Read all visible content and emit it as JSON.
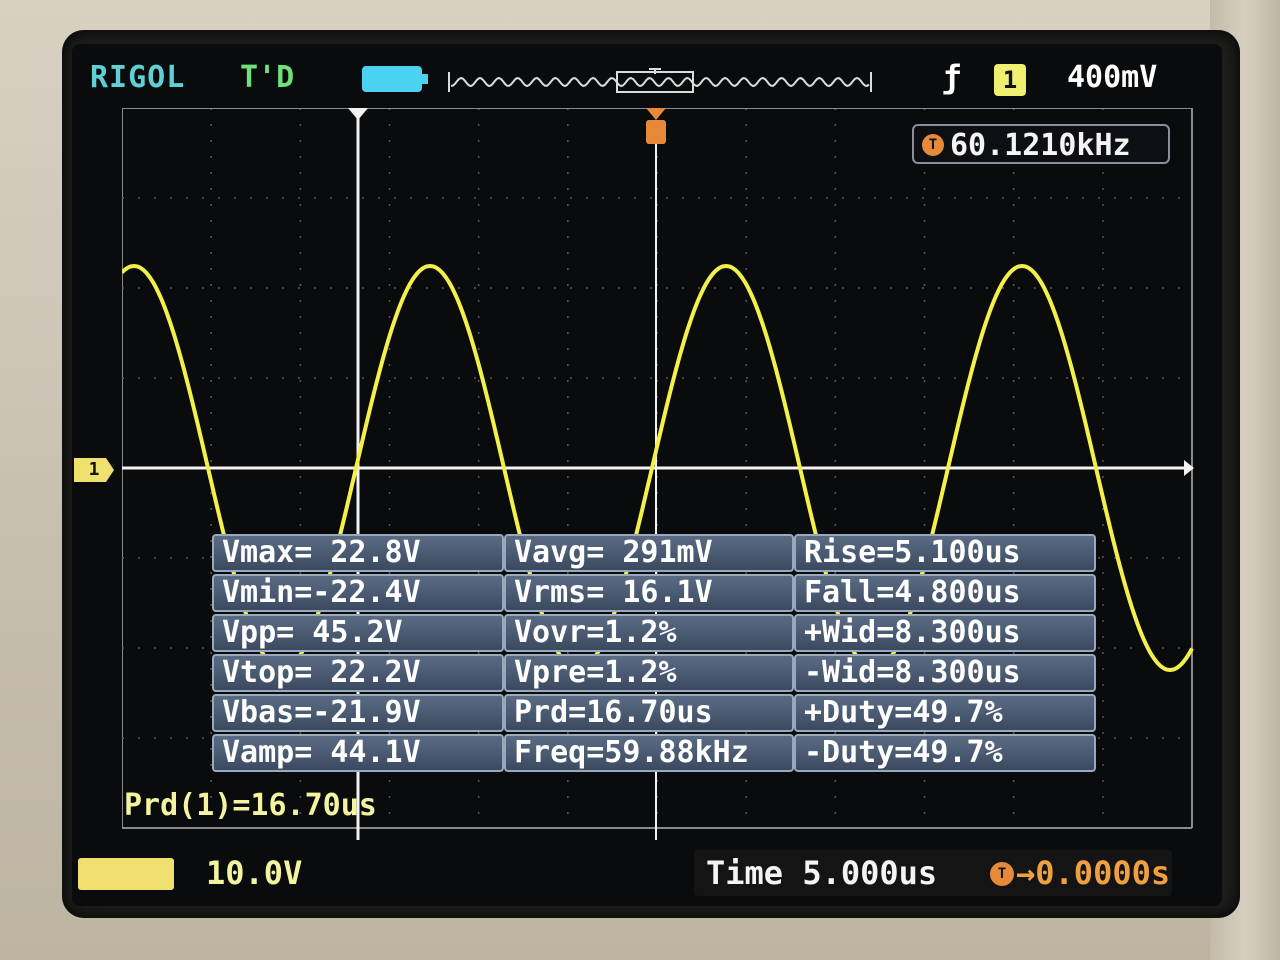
{
  "header": {
    "brand": "RIGOL",
    "trigger_status": "T'D",
    "battery_icon": "battery-icon",
    "trigger_slope_icon": "rising-edge-icon",
    "trigger_channel": "1",
    "trigger_level": "400mV"
  },
  "frequency_counter": {
    "label_icon": "T",
    "value": "60.1210kHz"
  },
  "channel_marker": "1",
  "waveform": {
    "type": "sine",
    "color": "#f4f04a",
    "grid_color": "#6a6a6a"
  },
  "measurements": {
    "col1": [
      "Vmax= 22.8V",
      "Vmin=-22.4V",
      "Vpp= 45.2V",
      "Vtop= 22.2V",
      "Vbas=-21.9V",
      "Vamp= 44.1V"
    ],
    "col2": [
      "Vavg= 291mV",
      "Vrms= 16.1V",
      "Vovr=1.2%",
      "Vpre=1.2%",
      "Prd=16.70us",
      "Freq=59.88kHz"
    ],
    "col3": [
      "Rise=5.100us",
      "Fall=4.800us",
      "+Wid=8.300us",
      "-Wid=8.300us",
      "+Duty=49.7%",
      "-Duty=49.7%"
    ]
  },
  "cursor_readout": "Prd(1)=16.70us",
  "footer": {
    "ch1_scale": "10.0V",
    "timebase": "Time 5.000us",
    "delay_icon": "T",
    "delay": "→0.0000s"
  },
  "colors": {
    "brand": "#5fd0d6",
    "trace": "#f4f04a",
    "accent_orange": "#f0a040",
    "measure_bg": "#4a5a72"
  }
}
